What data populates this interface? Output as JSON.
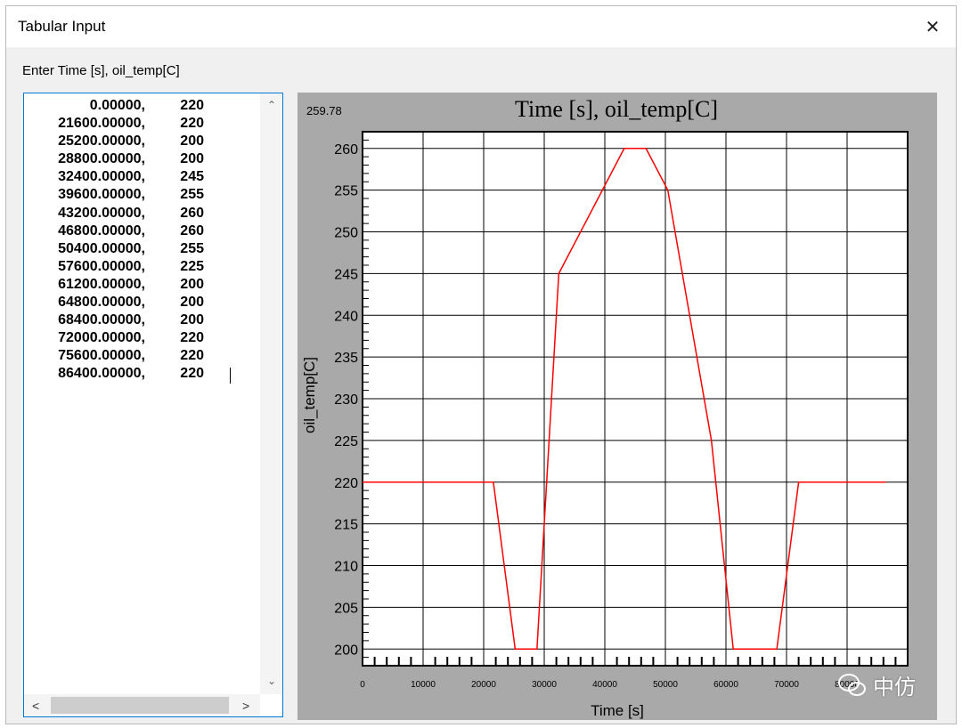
{
  "window": {
    "title": "Tabular Input",
    "close_glyph": "✕"
  },
  "prompt": "Enter Time [s], oil_temp[C]",
  "list": {
    "rows": [
      {
        "time": "0.00000,",
        "temp": "220"
      },
      {
        "time": "21600.00000,",
        "temp": "220"
      },
      {
        "time": "25200.00000,",
        "temp": "200"
      },
      {
        "time": "28800.00000,",
        "temp": "200"
      },
      {
        "time": "32400.00000,",
        "temp": "245"
      },
      {
        "time": "39600.00000,",
        "temp": "255"
      },
      {
        "time": "43200.00000,",
        "temp": "260"
      },
      {
        "time": "46800.00000,",
        "temp": "260"
      },
      {
        "time": "50400.00000,",
        "temp": "255"
      },
      {
        "time": "57600.00000,",
        "temp": "225"
      },
      {
        "time": "61200.00000,",
        "temp": "200"
      },
      {
        "time": "64800.00000,",
        "temp": "200"
      },
      {
        "time": "68400.00000,",
        "temp": "200"
      },
      {
        "time": "72000.00000,",
        "temp": "220"
      },
      {
        "time": "75600.00000,",
        "temp": "220"
      },
      {
        "time": "86400.00000,",
        "temp": "220"
      }
    ]
  },
  "watermark": {
    "text": "中仿",
    "icon": "wechat-icon"
  },
  "chart_data": {
    "type": "line",
    "title": "Time [s], oil_temp[C]",
    "corner_readout": "259.78",
    "xlabel": "Time [s]",
    "ylabel": "oil_temp[C]",
    "xlim": [
      0,
      90000
    ],
    "ylim": [
      198,
      262
    ],
    "xticks": [
      {
        "v": 0,
        "label": "0"
      },
      {
        "v": 10000,
        "label": "10000"
      },
      {
        "v": 20000,
        "label": "20000"
      },
      {
        "v": 30000,
        "label": "30000"
      },
      {
        "v": 40000,
        "label": "40000"
      },
      {
        "v": 50000,
        "label": "50000"
      },
      {
        "v": 60000,
        "label": "60000"
      },
      {
        "v": 70000,
        "label": "70000"
      },
      {
        "v": 80000,
        "label": "80000"
      }
    ],
    "yticks": [
      200,
      205,
      210,
      215,
      220,
      225,
      230,
      235,
      240,
      245,
      250,
      255,
      260
    ],
    "grid": true,
    "line_color": "#ff0000",
    "series": [
      {
        "x": [
          0,
          21600,
          25200,
          28800,
          32400,
          39600,
          43200,
          46800,
          50400,
          57600,
          61200,
          64800,
          68400,
          72000,
          75600,
          86400
        ],
        "y": [
          220,
          220,
          200,
          200,
          245,
          255,
          260,
          260,
          255,
          225,
          200,
          200,
          200,
          220,
          220,
          220
        ]
      }
    ]
  }
}
